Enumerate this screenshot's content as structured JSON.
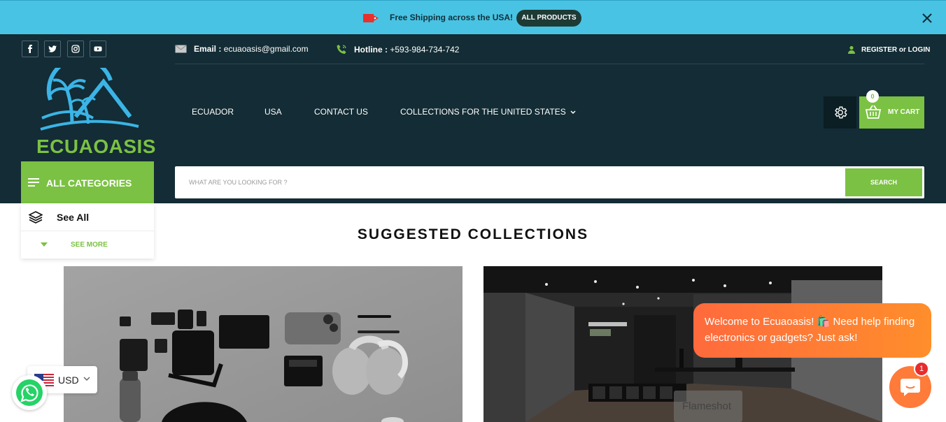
{
  "announcement": {
    "text": "Free Shipping across the USA!",
    "button": "ALL PRODUCTS",
    "icon": "shipping-tag-icon",
    "background": "#49c3e3"
  },
  "header": {
    "social": [
      "facebook-icon",
      "twitter-icon",
      "instagram-icon",
      "youtube-icon"
    ],
    "email_label": "Email :",
    "email_value": "ecuaoasis@gmail.com",
    "hotline_label": "Hotline :",
    "hotline_value": "+593-984-734-742",
    "account": "REGISTER or LOGIN",
    "logo_text": "ECUAOASIS",
    "background": "#132c35",
    "accent": "#7bc143"
  },
  "nav": {
    "items": [
      "ECUADOR",
      "USA",
      "CONTACT US",
      "COLLECTIONS FOR THE UNITED STATES"
    ]
  },
  "cart": {
    "label": "MY CART",
    "count": "0"
  },
  "categories": {
    "label": "ALL CATEGORIES",
    "see_all": "See All",
    "see_more": "SEE MORE"
  },
  "search": {
    "placeholder": "WHAT ARE YOU LOOKING FOR ?",
    "button": "SEARCH"
  },
  "main": {
    "section_title": "SUGGESTED COLLECTIONS"
  },
  "chat": {
    "message": "Welcome to Ecuaoasis! 🛍️ Need help finding electronics or gadgets? Just ask!",
    "badge": "1",
    "accent": "#ff7b39"
  },
  "overlay": {
    "flameshot": "Flameshot"
  },
  "currency": {
    "code": "USD"
  }
}
